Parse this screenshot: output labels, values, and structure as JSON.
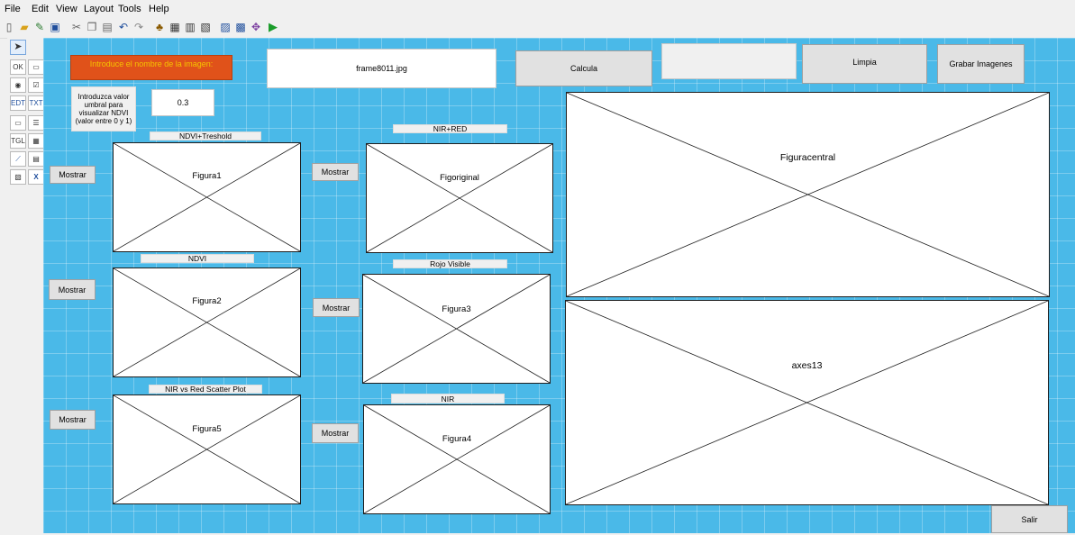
{
  "menu": [
    "File",
    "Edit",
    "View",
    "Layout",
    "Tools",
    "Help"
  ],
  "toolbar_icons": [
    "new-file-icon",
    "open-icon",
    "edit-icon",
    "save-icon",
    "cut-icon",
    "copy-icon",
    "paste-icon",
    "undo-icon",
    "redo-icon",
    "align-icon",
    "menu-editor-icon",
    "tab-order-icon",
    "toolbar-editor-icon",
    "mfile-editor-icon",
    "property-inspector-icon",
    "object-browser-icon",
    "run-icon"
  ],
  "palette": [
    "select-tool",
    "push-button-tool",
    "slider-tool",
    "radio-button-tool",
    "checkbox-tool",
    "edit-text-tool",
    "static-text-tool",
    "popup-menu-tool",
    "listbox-tool",
    "toggle-button-tool",
    "table-tool",
    "axes-tool",
    "panel-tool",
    "button-group-tool",
    "activex-tool"
  ],
  "header": {
    "prompt_label": "Introduce el nombre de la imagen:",
    "filename": "frame8011.jpg",
    "calcula": "Calcula",
    "blank_field": "",
    "limpia": "Limpia",
    "grabar": "Grabar Imagenes"
  },
  "threshold": {
    "label": "Introduzca valor umbral para visualizar NDVI (valor entre 0 y 1)",
    "value": "0.3"
  },
  "panels": {
    "ndvi_treshold": "NDVI+Treshold",
    "ndvi": "NDVI",
    "scatter": "NIR vs Red Scatter Plot",
    "nir_red": "NIR+RED",
    "rojo": "Rojo Visible",
    "nir": "NIR"
  },
  "axes": {
    "figura1": "Figura1",
    "figura2": "Figura2",
    "figura5": "Figura5",
    "figoriginal": "Figoriginal",
    "figura3": "Figura3",
    "figura4": "Figura4",
    "figuracentral": "Figuracentral",
    "axes13": "axes13"
  },
  "buttons": {
    "mostrar": "Mostrar",
    "salir": "Salir"
  },
  "colors": {
    "canvas": "#4ab9e8",
    "prompt_bg": "#e0521a",
    "prompt_text": "#f5c400"
  }
}
